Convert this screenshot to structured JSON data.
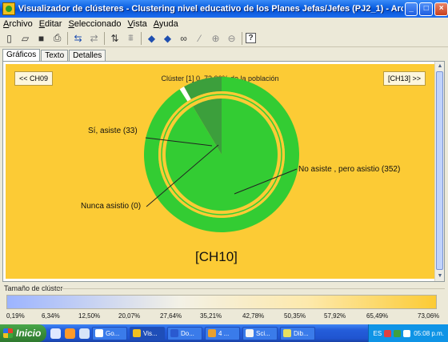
{
  "window": {
    "title": "Visualizador de clústeres - Clustering nivel educativo de los Planes Jefas/Jefes (PJ2_1) - Archivo local: general I...",
    "buttons": {
      "minimize": "_",
      "maximize": "□",
      "close": "×"
    }
  },
  "menu": [
    "Archivo",
    "Editar",
    "Seleccionado",
    "Vista",
    "Ayuda"
  ],
  "toolbar": {
    "icons": [
      "new-icon",
      "open-icon",
      "save-icon",
      "print-icon",
      "refresh-icon",
      "swap-icon",
      "sort-icon",
      "filter-icon",
      "arrow-left-icon",
      "arrow-right-icon",
      "binoculars-icon",
      "magic-wand-icon",
      "zoom-in-icon",
      "zoom-out-icon",
      "help-icon"
    ],
    "help_label": "?"
  },
  "tabs": [
    "Gráficos",
    "Texto",
    "Detalles"
  ],
  "chart": {
    "prev_button": "<< CH09",
    "next_button": "[CH13] >>",
    "title": "Clúster [1] 0, 73,06% de la población",
    "center_label": "[CH10]",
    "label_yes": "Sí, asiste (33)",
    "label_no": "No asiste , pero asistio (352)",
    "label_never": "Nunca asistio (0)"
  },
  "chart_data": {
    "type": "pie",
    "title": "Clúster [1] 0, 73,06% de la población",
    "inner": [
      {
        "name": "Sí, asiste",
        "value": 33,
        "color": "#3c9f3c"
      },
      {
        "name": "No asiste , pero asistio",
        "value": 352,
        "color": "#33cc33"
      },
      {
        "name": "Nunca asistio",
        "value": 0,
        "color": "#33cc33"
      }
    ],
    "outer": [
      {
        "name": "Sí, asiste",
        "value": 31,
        "color": "#3c9f3c"
      },
      {
        "name": "white",
        "value": 4,
        "color": "#ffffff"
      },
      {
        "name": "No asiste , pero asistio",
        "value": 350,
        "color": "#33cc33"
      }
    ]
  },
  "size_section": {
    "title": "Tamaño de clúster",
    "ticks": [
      "0,19%",
      "6,34%",
      "12,50%",
      "20,07%",
      "27,64%",
      "35,21%",
      "42,78%",
      "50,35%",
      "57,92%",
      "65,49%",
      "73,06%"
    ]
  },
  "taskbar": {
    "start": "Inicio",
    "tasks": [
      "Go...",
      "Vis...",
      "Do...",
      "4 ...",
      "Sci...",
      "Dib..."
    ],
    "lang": "ES",
    "time": "05:08 p.m."
  }
}
